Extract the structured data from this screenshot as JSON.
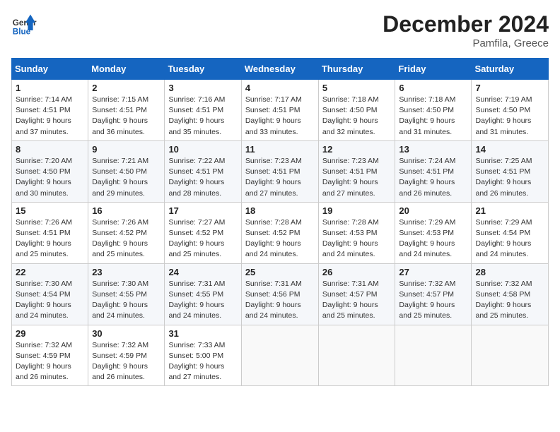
{
  "header": {
    "logo_line1": "General",
    "logo_line2": "Blue",
    "month": "December 2024",
    "location": "Pamfila, Greece"
  },
  "weekdays": [
    "Sunday",
    "Monday",
    "Tuesday",
    "Wednesday",
    "Thursday",
    "Friday",
    "Saturday"
  ],
  "weeks": [
    [
      {
        "day": "1",
        "info": "Sunrise: 7:14 AM\nSunset: 4:51 PM\nDaylight: 9 hours\nand 37 minutes."
      },
      {
        "day": "2",
        "info": "Sunrise: 7:15 AM\nSunset: 4:51 PM\nDaylight: 9 hours\nand 36 minutes."
      },
      {
        "day": "3",
        "info": "Sunrise: 7:16 AM\nSunset: 4:51 PM\nDaylight: 9 hours\nand 35 minutes."
      },
      {
        "day": "4",
        "info": "Sunrise: 7:17 AM\nSunset: 4:51 PM\nDaylight: 9 hours\nand 33 minutes."
      },
      {
        "day": "5",
        "info": "Sunrise: 7:18 AM\nSunset: 4:50 PM\nDaylight: 9 hours\nand 32 minutes."
      },
      {
        "day": "6",
        "info": "Sunrise: 7:18 AM\nSunset: 4:50 PM\nDaylight: 9 hours\nand 31 minutes."
      },
      {
        "day": "7",
        "info": "Sunrise: 7:19 AM\nSunset: 4:50 PM\nDaylight: 9 hours\nand 31 minutes."
      }
    ],
    [
      {
        "day": "8",
        "info": "Sunrise: 7:20 AM\nSunset: 4:50 PM\nDaylight: 9 hours\nand 30 minutes."
      },
      {
        "day": "9",
        "info": "Sunrise: 7:21 AM\nSunset: 4:50 PM\nDaylight: 9 hours\nand 29 minutes."
      },
      {
        "day": "10",
        "info": "Sunrise: 7:22 AM\nSunset: 4:51 PM\nDaylight: 9 hours\nand 28 minutes."
      },
      {
        "day": "11",
        "info": "Sunrise: 7:23 AM\nSunset: 4:51 PM\nDaylight: 9 hours\nand 27 minutes."
      },
      {
        "day": "12",
        "info": "Sunrise: 7:23 AM\nSunset: 4:51 PM\nDaylight: 9 hours\nand 27 minutes."
      },
      {
        "day": "13",
        "info": "Sunrise: 7:24 AM\nSunset: 4:51 PM\nDaylight: 9 hours\nand 26 minutes."
      },
      {
        "day": "14",
        "info": "Sunrise: 7:25 AM\nSunset: 4:51 PM\nDaylight: 9 hours\nand 26 minutes."
      }
    ],
    [
      {
        "day": "15",
        "info": "Sunrise: 7:26 AM\nSunset: 4:51 PM\nDaylight: 9 hours\nand 25 minutes."
      },
      {
        "day": "16",
        "info": "Sunrise: 7:26 AM\nSunset: 4:52 PM\nDaylight: 9 hours\nand 25 minutes."
      },
      {
        "day": "17",
        "info": "Sunrise: 7:27 AM\nSunset: 4:52 PM\nDaylight: 9 hours\nand 25 minutes."
      },
      {
        "day": "18",
        "info": "Sunrise: 7:28 AM\nSunset: 4:52 PM\nDaylight: 9 hours\nand 24 minutes."
      },
      {
        "day": "19",
        "info": "Sunrise: 7:28 AM\nSunset: 4:53 PM\nDaylight: 9 hours\nand 24 minutes."
      },
      {
        "day": "20",
        "info": "Sunrise: 7:29 AM\nSunset: 4:53 PM\nDaylight: 9 hours\nand 24 minutes."
      },
      {
        "day": "21",
        "info": "Sunrise: 7:29 AM\nSunset: 4:54 PM\nDaylight: 9 hours\nand 24 minutes."
      }
    ],
    [
      {
        "day": "22",
        "info": "Sunrise: 7:30 AM\nSunset: 4:54 PM\nDaylight: 9 hours\nand 24 minutes."
      },
      {
        "day": "23",
        "info": "Sunrise: 7:30 AM\nSunset: 4:55 PM\nDaylight: 9 hours\nand 24 minutes."
      },
      {
        "day": "24",
        "info": "Sunrise: 7:31 AM\nSunset: 4:55 PM\nDaylight: 9 hours\nand 24 minutes."
      },
      {
        "day": "25",
        "info": "Sunrise: 7:31 AM\nSunset: 4:56 PM\nDaylight: 9 hours\nand 24 minutes."
      },
      {
        "day": "26",
        "info": "Sunrise: 7:31 AM\nSunset: 4:57 PM\nDaylight: 9 hours\nand 25 minutes."
      },
      {
        "day": "27",
        "info": "Sunrise: 7:32 AM\nSunset: 4:57 PM\nDaylight: 9 hours\nand 25 minutes."
      },
      {
        "day": "28",
        "info": "Sunrise: 7:32 AM\nSunset: 4:58 PM\nDaylight: 9 hours\nand 25 minutes."
      }
    ],
    [
      {
        "day": "29",
        "info": "Sunrise: 7:32 AM\nSunset: 4:59 PM\nDaylight: 9 hours\nand 26 minutes."
      },
      {
        "day": "30",
        "info": "Sunrise: 7:32 AM\nSunset: 4:59 PM\nDaylight: 9 hours\nand 26 minutes."
      },
      {
        "day": "31",
        "info": "Sunrise: 7:33 AM\nSunset: 5:00 PM\nDaylight: 9 hours\nand 27 minutes."
      },
      null,
      null,
      null,
      null
    ]
  ]
}
